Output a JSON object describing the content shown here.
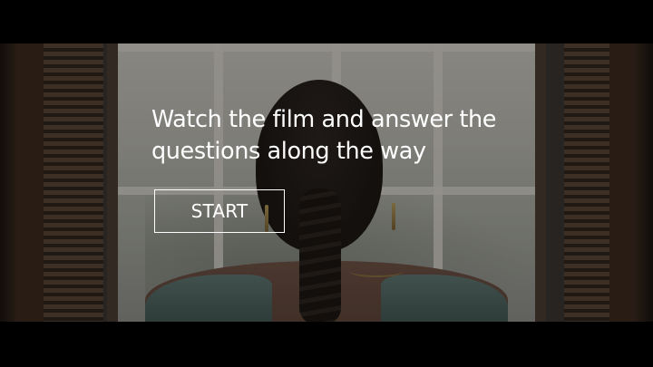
{
  "overlay": {
    "intro_line_1": "Watch the film and answer the",
    "intro_line_2": "questions along the way",
    "start_label": "START"
  },
  "colors": {
    "letterbox": "#000000",
    "text": "#ffffff",
    "button_border": "#ffffff"
  }
}
